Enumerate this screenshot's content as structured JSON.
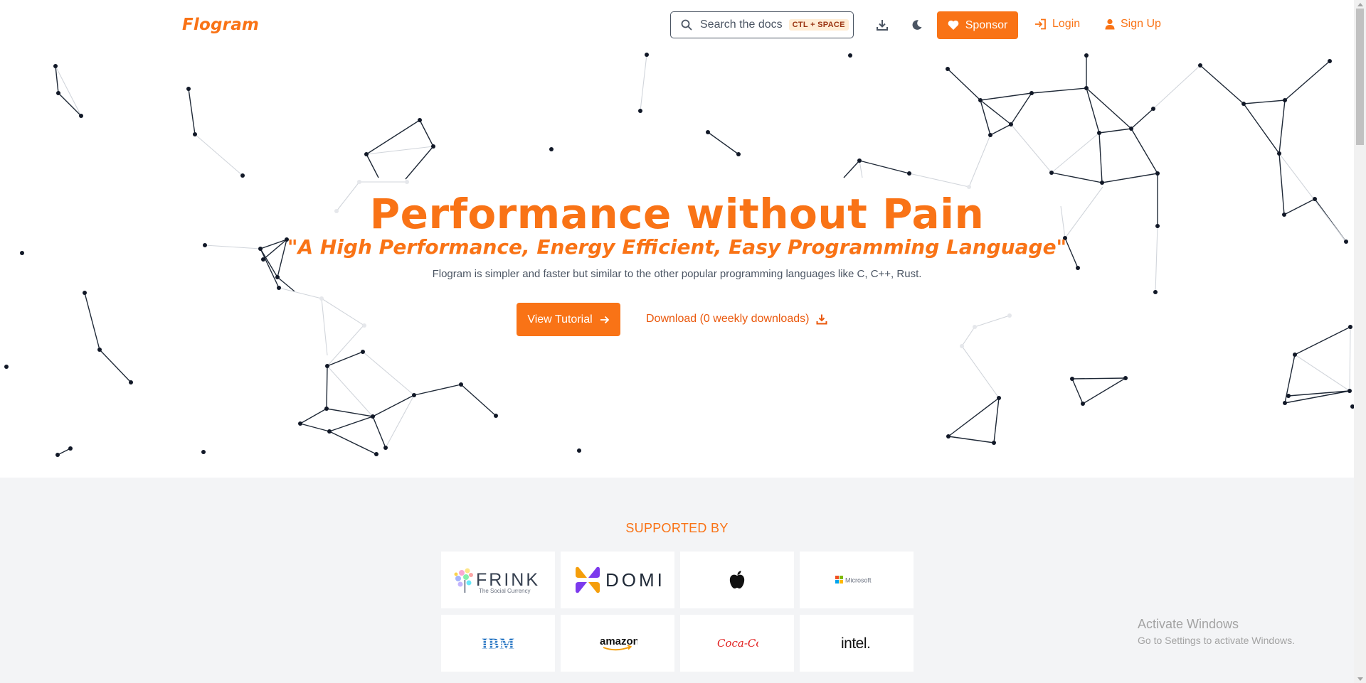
{
  "navbar": {
    "logo": "Flogram",
    "search_placeholder": "Search the docs",
    "search_shortcut": "CTL + SPACE",
    "sponsor_label": "Sponsor",
    "login_label": "Login",
    "signup_label": "Sign Up",
    "icons": [
      "search-icon",
      "download-icon",
      "moon-icon",
      "heart-icon",
      "login-icon",
      "user-icon"
    ]
  },
  "hero": {
    "headline": "Performance without Pain",
    "tagline": "\"A High Performance, Energy Efficient, Easy Programming Language\"",
    "subtitle": "Flogram is simpler and faster but similar to the other popular programming languages like C, C++, Rust.",
    "tutorial_button": "View Tutorial",
    "download_link": "Download (0 weekly downloads)"
  },
  "supported": {
    "title": "SUPPORTED BY",
    "sponsors": [
      "FRINK",
      "DOMI",
      "Apple",
      "Microsoft",
      "IBM",
      "amazon",
      "Coca-Cola",
      "intel."
    ],
    "frink_tagline": "The Social Currency",
    "microsoft_text": "Microsoft",
    "ibm_text": "IBM",
    "amazon_text": "amazon",
    "cocacola_text": "Coca-Cola",
    "intel_text": "intel."
  },
  "watermark": {
    "title": "Activate Windows",
    "subtitle": "Go to Settings to activate Windows."
  },
  "colors": {
    "accent": "#f97316",
    "accent_dark": "#ea580c",
    "section_bg": "#f3f4f6"
  }
}
